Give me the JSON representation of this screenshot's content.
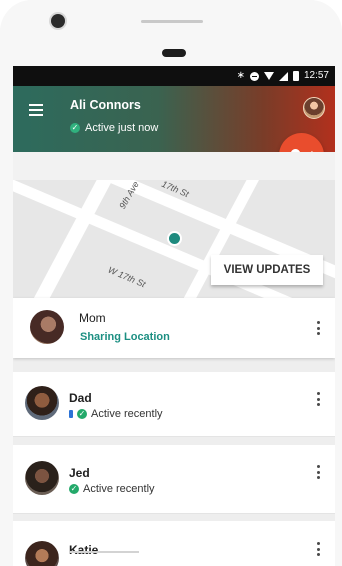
{
  "status_bar": {
    "time": "12:57"
  },
  "header": {
    "name": "Ali Connors",
    "status": "Active just now"
  },
  "map": {
    "labels": [
      {
        "text": "9th Ave"
      },
      {
        "text": "17th St"
      },
      {
        "text": "W 17th St"
      }
    ],
    "view_updates_label": "VIEW UPDATES"
  },
  "contacts": [
    {
      "name": "Mom",
      "status": "Sharing Location"
    },
    {
      "name": "Dad",
      "status": "Active recently"
    },
    {
      "name": "Jed",
      "status": "Active recently"
    },
    {
      "name": "Katie",
      "status": ""
    }
  ],
  "colors": {
    "accent_green": "#1c8f82",
    "fab_red": "#e94d2d",
    "header_start": "#2d6b5d",
    "header_end": "#b2301d"
  },
  "icons": {
    "menu": "menu-icon",
    "location": "location-share-icon",
    "more": "more-vert-icon"
  }
}
